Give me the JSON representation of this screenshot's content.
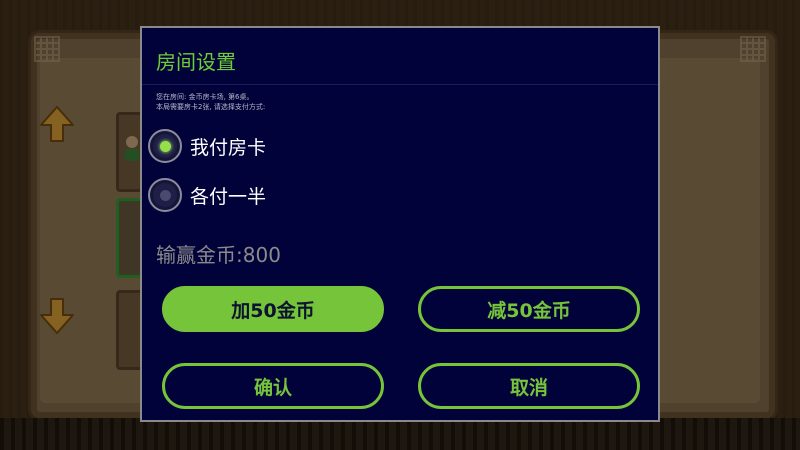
{
  "dialog": {
    "title": "房间设置",
    "notice_lines": [
      "您在房间: 金币房卡场, 第6桌。",
      "本局需要房卡2张, 请选择支付方式:"
    ],
    "options": [
      {
        "label": "我付房卡",
        "selected": true
      },
      {
        "label": "各付一半",
        "selected": false
      }
    ],
    "coin_label": "输赢金币",
    "coin_separator": ":",
    "coin_value": "800",
    "buttons": {
      "add": "加50金币",
      "subtract": "减50金币",
      "confirm": "确认",
      "cancel": "取消"
    }
  },
  "colors": {
    "accent": "#76c43a",
    "dialog_bg": "#02023a",
    "title": "#6fce35",
    "muted_text": "#8b8b8b"
  },
  "icons": [
    "up-arrow-icon",
    "down-arrow-icon",
    "avatar-icon"
  ]
}
